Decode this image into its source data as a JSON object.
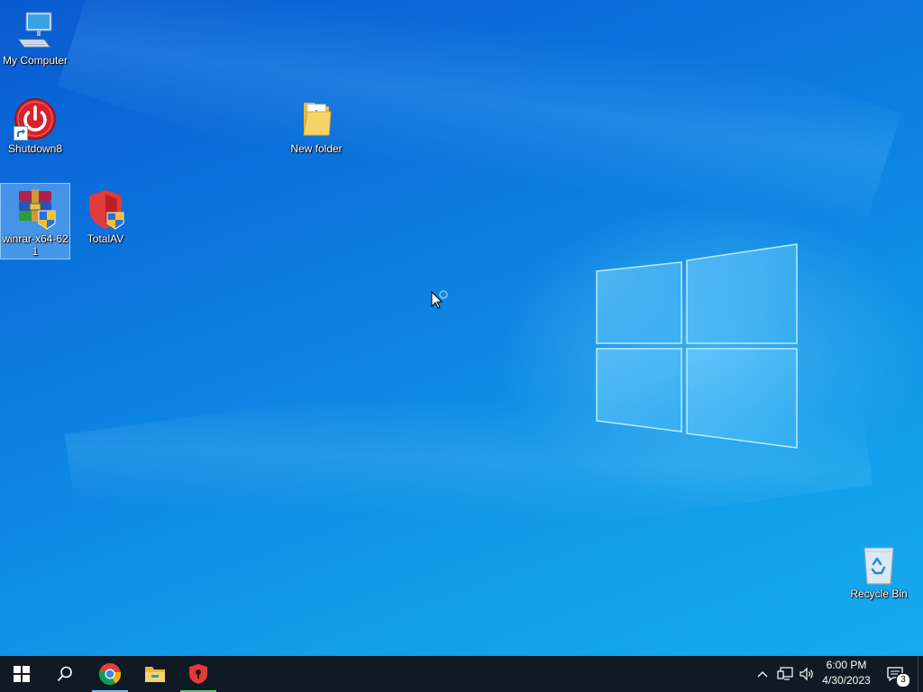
{
  "desktop": {
    "icons": [
      {
        "label": "My Computer"
      },
      {
        "label": "Shutdown8"
      },
      {
        "label": "New folder"
      },
      {
        "label": "winrar-x64-621"
      },
      {
        "label": "TotalAV"
      },
      {
        "label": "Recycle Bin"
      }
    ]
  },
  "taskbar": {
    "start": {
      "icon": "windows-logo-icon"
    },
    "search": {
      "icon": "search-icon"
    },
    "pinned": [
      {
        "name": "Google Chrome",
        "icon": "chrome-icon",
        "running": true
      },
      {
        "name": "File Explorer",
        "icon": "folder-icon",
        "running": false
      },
      {
        "name": "TotalAV",
        "icon": "totalav-shield-icon",
        "running": true
      }
    ],
    "tray": {
      "time": "6:00 PM",
      "date": "4/30/2023",
      "notification_count": "3"
    }
  },
  "colors": {
    "taskbar_bg": "#0f1a24",
    "desktop_top": "#0a5ad0",
    "desktop_bottom": "#18aaee",
    "running_indicator": "#76b9ed"
  }
}
